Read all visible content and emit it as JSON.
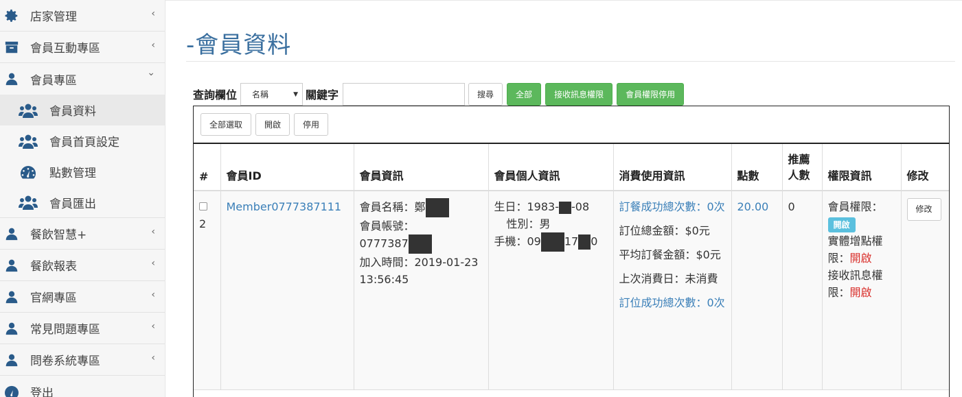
{
  "sidebar": {
    "items": [
      {
        "label": "店家管理",
        "icon": "gear-icon",
        "chevron": "‹"
      },
      {
        "label": "會員互動專區",
        "icon": "archive-icon",
        "chevron": "‹"
      },
      {
        "label": "會員專區",
        "icon": "user-icon",
        "chevron": "⌄"
      },
      {
        "label": "餐飲智慧+",
        "icon": "user-icon",
        "chevron": "‹"
      },
      {
        "label": "餐飲報表",
        "icon": "user-icon",
        "chevron": "‹"
      },
      {
        "label": "官網專區",
        "icon": "user-icon",
        "chevron": "‹"
      },
      {
        "label": "常見問題專區",
        "icon": "user-icon",
        "chevron": "‹"
      },
      {
        "label": "問卷系統專區",
        "icon": "user-icon",
        "chevron": "‹"
      },
      {
        "label": "登出",
        "icon": "dashboard-icon",
        "chevron": ""
      }
    ],
    "subitems": [
      {
        "label": "會員資料",
        "icon": "users-icon"
      },
      {
        "label": "會員首頁設定",
        "icon": "users-icon"
      },
      {
        "label": "點數管理",
        "icon": "dashboard-icon"
      },
      {
        "label": "會員匯出",
        "icon": "users-icon"
      }
    ]
  },
  "page": {
    "title": "-會員資料"
  },
  "search": {
    "field_label": "查詢欄位",
    "field_value": "名稱",
    "keyword_label": "關鍵字",
    "keyword_value": "",
    "search_button": "搜尋",
    "all_button": "全部",
    "receive_msg_button": "接收訊息權限",
    "disable_member_button": "會員權限停用"
  },
  "actions": {
    "select_all": "全部選取",
    "enable": "開啟",
    "disable": "停用"
  },
  "table": {
    "headers": [
      "#",
      "會員ID",
      "會員資訊",
      "會員個人資訊",
      "消費使用資訊",
      "點數",
      "推薦人數",
      "權限資訊",
      "修改"
    ],
    "row": {
      "index": "2",
      "member_id": "Member0777387111",
      "info_name_label": "會員名稱：鄭",
      "info_account_label": "會員帳號：",
      "info_account_value": "0777387",
      "info_join": "加入時間：2019-01-23 13:56:45",
      "personal_birthday_a": "生日：1983-",
      "personal_birthday_b": "-08",
      "personal_gender": "性別：男",
      "personal_phone_a": "手機：09",
      "personal_phone_b": "17",
      "personal_phone_c": "0",
      "consume_order_count": "訂餐成功總次數：0次",
      "consume_booking_total": "訂位總金額：$0元",
      "consume_avg": "平均訂餐金額：$0元",
      "consume_last": "上次消費日：未消費",
      "consume_booking_count": "訂位成功總次數：0次",
      "points": "20.00",
      "referrals": "0",
      "perm_member_label": "會員權限：",
      "perm_member_badge": "開啟",
      "perm_points_label": "實體增點權限：",
      "perm_points_value": "開啟",
      "perm_msg_label": "接收訊息權限：",
      "perm_msg_value": "開啟",
      "edit_button": "修改"
    }
  },
  "colors": {
    "accent": "#3a7fb8",
    "green": "#5cb85c",
    "badge": "#5bc0de",
    "red": "#d9302c",
    "icon": "#2a5b8a"
  }
}
